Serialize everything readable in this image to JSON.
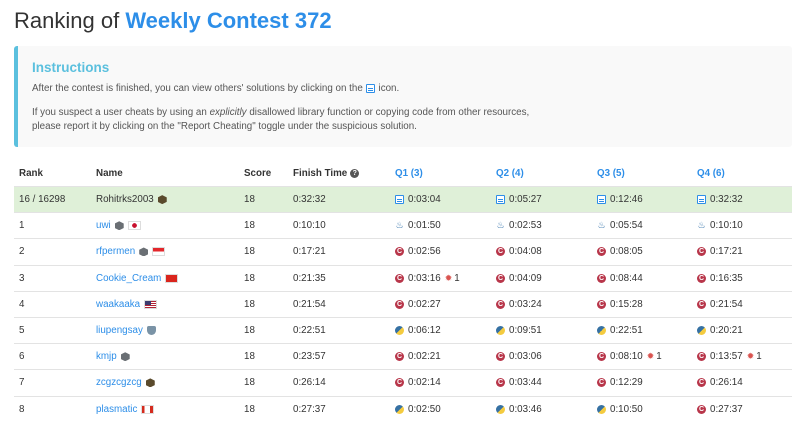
{
  "page": {
    "title_prefix": "Ranking of",
    "contest_name": "Weekly Contest 372"
  },
  "instructions": {
    "heading": "Instructions",
    "line1_before": "After the contest is finished, you can view others' solutions by clicking on the",
    "line1_after": "icon.",
    "line2_before": "If you suspect a user cheats by using an",
    "line2_em": "explicitly",
    "line2_after": "disallowed library function or copying code from other resources,",
    "line3": "please report it by clicking on the \"Report Cheating\" toggle under the suspicious solution."
  },
  "table": {
    "headers": {
      "rank": "Rank",
      "name": "Name",
      "score": "Score",
      "finish_time": "Finish Time",
      "q1": "Q1 (3)",
      "q2": "Q2 (4)",
      "q3": "Q3 (5)",
      "q4": "Q4 (6)"
    },
    "rows": [
      {
        "rank": "16 / 16298",
        "name": "Rohitrks2003",
        "badge": "hex",
        "flag": "",
        "score": "18",
        "time": "0:32:32",
        "q": [
          {
            "lang": "file",
            "t": "0:03:04"
          },
          {
            "lang": "file",
            "t": "0:05:27"
          },
          {
            "lang": "file",
            "t": "0:12:46"
          },
          {
            "lang": "file",
            "t": "0:32:32"
          }
        ]
      },
      {
        "rank": "1",
        "name": "uwi",
        "badge": "gray",
        "flag": "jp",
        "score": "18",
        "time": "0:10:10",
        "q": [
          {
            "lang": "java",
            "t": "0:01:50"
          },
          {
            "lang": "java",
            "t": "0:02:53"
          },
          {
            "lang": "java",
            "t": "0:05:54"
          },
          {
            "lang": "java",
            "t": "0:10:10"
          }
        ]
      },
      {
        "rank": "2",
        "name": "rfpermen",
        "badge": "gray",
        "flag": "id",
        "score": "18",
        "time": "0:17:21",
        "q": [
          {
            "lang": "c",
            "t": "0:02:56"
          },
          {
            "lang": "c",
            "t": "0:04:08"
          },
          {
            "lang": "c",
            "t": "0:08:05"
          },
          {
            "lang": "c",
            "t": "0:17:21"
          }
        ]
      },
      {
        "rank": "3",
        "name": "Cookie_Cream",
        "badge": "",
        "flag": "vn",
        "score": "18",
        "time": "0:21:35",
        "q": [
          {
            "lang": "c",
            "t": "0:03:16",
            "bug": "1"
          },
          {
            "lang": "c",
            "t": "0:04:09"
          },
          {
            "lang": "c",
            "t": "0:08:44"
          },
          {
            "lang": "c",
            "t": "0:16:35"
          }
        ]
      },
      {
        "rank": "4",
        "name": "waakaaka",
        "badge": "",
        "flag": "us",
        "score": "18",
        "time": "0:21:54",
        "q": [
          {
            "lang": "c",
            "t": "0:02:27"
          },
          {
            "lang": "c",
            "t": "0:03:24"
          },
          {
            "lang": "c",
            "t": "0:15:28"
          },
          {
            "lang": "c",
            "t": "0:21:54"
          }
        ]
      },
      {
        "rank": "5",
        "name": "liupengsay",
        "badge": "shield",
        "flag": "",
        "score": "18",
        "time": "0:22:51",
        "q": [
          {
            "lang": "py",
            "t": "0:06:12"
          },
          {
            "lang": "py",
            "t": "0:09:51"
          },
          {
            "lang": "py",
            "t": "0:22:51"
          },
          {
            "lang": "py",
            "t": "0:20:21"
          }
        ]
      },
      {
        "rank": "6",
        "name": "kmjp",
        "badge": "gray",
        "flag": "",
        "score": "18",
        "time": "0:23:57",
        "q": [
          {
            "lang": "c",
            "t": "0:02:21"
          },
          {
            "lang": "c",
            "t": "0:03:06"
          },
          {
            "lang": "c",
            "t": "0:08:10",
            "bug": "1"
          },
          {
            "lang": "c",
            "t": "0:13:57",
            "bug": "1"
          }
        ]
      },
      {
        "rank": "7",
        "name": "zcgzcgzcg",
        "badge": "hex",
        "flag": "",
        "score": "18",
        "time": "0:26:14",
        "q": [
          {
            "lang": "c",
            "t": "0:02:14"
          },
          {
            "lang": "c",
            "t": "0:03:44"
          },
          {
            "lang": "c",
            "t": "0:12:29"
          },
          {
            "lang": "c",
            "t": "0:26:14"
          }
        ]
      },
      {
        "rank": "8",
        "name": "plasmatic",
        "badge": "",
        "flag": "ca",
        "score": "18",
        "time": "0:27:37",
        "q": [
          {
            "lang": "py",
            "t": "0:02:50"
          },
          {
            "lang": "py",
            "t": "0:03:46"
          },
          {
            "lang": "py",
            "t": "0:10:50"
          },
          {
            "lang": "c",
            "t": "0:27:37"
          }
        ]
      }
    ]
  },
  "colors": {
    "accent": "#2d8ee8",
    "info": "#5bc0de",
    "highlight_row": "#dff0d8",
    "bug": "#d9534f"
  },
  "icons": {
    "file": "solution-file-icon",
    "java": "java-icon",
    "c": "cpp-icon",
    "py": "python-icon",
    "bug": "bug-icon"
  }
}
